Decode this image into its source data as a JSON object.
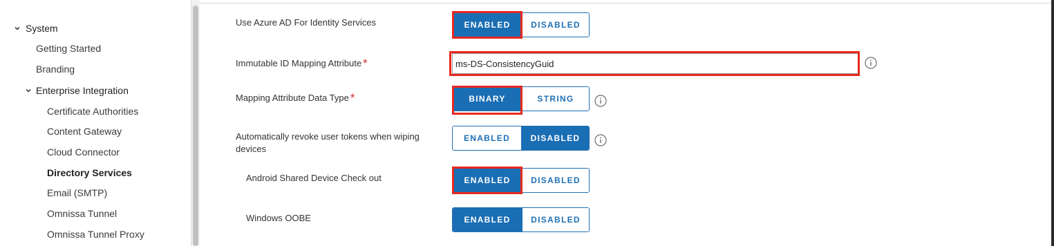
{
  "sidebar": {
    "system": "System",
    "getting_started": "Getting Started",
    "branding": "Branding",
    "enterprise_integration": "Enterprise Integration",
    "certificate_authorities": "Certificate Authorities",
    "content_gateway": "Content Gateway",
    "cloud_connector": "Cloud Connector",
    "directory_services": "Directory Services",
    "email_smtp": "Email (SMTP)",
    "omnissa_tunnel": "Omnissa Tunnel",
    "omnissa_tunnel_proxy": "Omnissa Tunnel Proxy"
  },
  "form": {
    "azure_ad": {
      "label": "Use Azure AD For Identity Services",
      "options": [
        "ENABLED",
        "DISABLED"
      ],
      "selected": "ENABLED"
    },
    "immutable_id": {
      "label": "Immutable ID Mapping Attribute",
      "required_mark": "*",
      "value": "ms-DS-ConsistencyGuid"
    },
    "data_type": {
      "label": "Mapping Attribute Data Type",
      "required_mark": "*",
      "options": [
        "BINARY",
        "STRING"
      ],
      "selected": "BINARY"
    },
    "revoke_tokens": {
      "label": "Automatically revoke user tokens when wiping devices",
      "options": [
        "ENABLED",
        "DISABLED"
      ],
      "selected": "DISABLED"
    },
    "android_shared": {
      "label": "Android Shared Device Check out",
      "options": [
        "ENABLED",
        "DISABLED"
      ],
      "selected": "ENABLED"
    },
    "windows_oobe": {
      "label": "Windows OOBE",
      "options": [
        "ENABLED",
        "DISABLED"
      ],
      "selected": "ENABLED"
    }
  },
  "colors": {
    "primary": "#1a6eb4",
    "highlight": "#e8281e",
    "required": "#d0312d"
  },
  "icons": {
    "expand": "chevron-down-icon",
    "info": "info-icon"
  }
}
